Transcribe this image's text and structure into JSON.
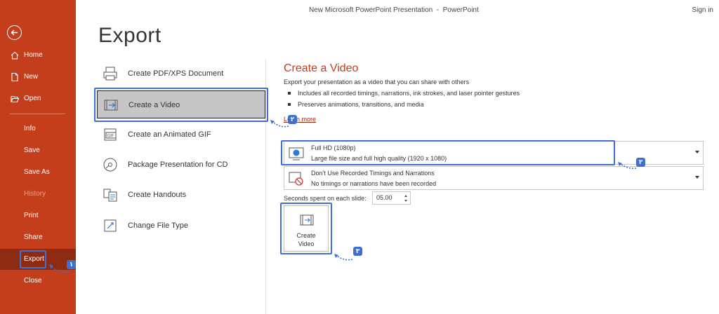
{
  "window": {
    "title": "New Microsoft PowerPoint Presentation  -  PowerPoint",
    "sign_in": "Sign in"
  },
  "sidebar": {
    "items": [
      {
        "label": "Home",
        "icon": "home-icon"
      },
      {
        "label": "New",
        "icon": "new-file-icon"
      },
      {
        "label": "Open",
        "icon": "folder-open-icon"
      },
      {
        "label": "Info"
      },
      {
        "label": "Save"
      },
      {
        "label": "Save As"
      },
      {
        "label": "History",
        "disabled": true
      },
      {
        "label": "Print"
      },
      {
        "label": "Share"
      },
      {
        "label": "Export",
        "active": true
      },
      {
        "label": "Close"
      }
    ]
  },
  "page_title": "Export",
  "options": [
    {
      "label": "Create PDF/XPS Document",
      "icon": "pdf-document-icon"
    },
    {
      "label": "Create a Video",
      "icon": "video-film-icon",
      "selected": true
    },
    {
      "label": "Create an Animated GIF",
      "icon": "gif-icon"
    },
    {
      "label": "Package Presentation for CD",
      "icon": "cd-disc-icon"
    },
    {
      "label": "Create Handouts",
      "icon": "handouts-icon"
    },
    {
      "label": "Change File Type",
      "icon": "change-file-type-icon"
    }
  ],
  "video_panel": {
    "title": "Create a Video",
    "description": "Export your presentation as a video that you can share with others",
    "bullets": [
      "Includes all recorded timings, narrations, ink strokes, and laser pointer gestures",
      "Preserves animations, transitions, and media"
    ],
    "learn_more": "Learn more",
    "quality": {
      "title": "Full HD (1080p)",
      "subtitle": "Large file size and full high quality (1920 x 1080)"
    },
    "timings": {
      "title": "Don't Use Recorded Timings and Narrations",
      "subtitle": "No timings or narrations have been recorded"
    },
    "seconds_label": "Seconds spent on each slide:",
    "seconds_value": "05.00",
    "create_button": {
      "line1": "Create",
      "line2": "Video"
    }
  },
  "annotations": {
    "step1": "۱",
    "step2": "۲",
    "step3": "۳",
    "step3b": "۳"
  },
  "colors": {
    "accent": "#c43e1c",
    "highlight": "#3f6fd1"
  }
}
